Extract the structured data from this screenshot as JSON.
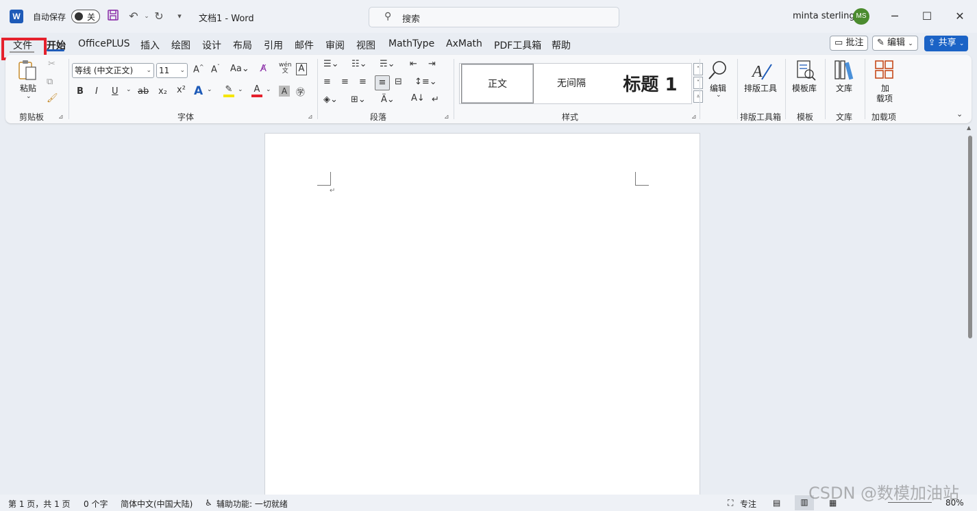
{
  "titlebar": {
    "app_logo": "W",
    "autosave_label": "自动保存",
    "autosave_state": "关",
    "doc_title": "文档1  -  Word",
    "search_placeholder": "搜索",
    "user_name": "minta sterling",
    "user_initials": "MS",
    "minimize": "─",
    "maximize": "☐",
    "close": "✕"
  },
  "tabs": [
    {
      "label": "文件"
    },
    {
      "label": "开始"
    },
    {
      "label": "OfficePLUS"
    },
    {
      "label": "插入"
    },
    {
      "label": "绘图"
    },
    {
      "label": "设计"
    },
    {
      "label": "布局"
    },
    {
      "label": "引用"
    },
    {
      "label": "邮件"
    },
    {
      "label": "审阅"
    },
    {
      "label": "视图"
    },
    {
      "label": "MathType"
    },
    {
      "label": "AxMath"
    },
    {
      "label": "PDF工具箱"
    },
    {
      "label": "帮助"
    }
  ],
  "header_buttons": {
    "comment": "批注",
    "edit": "编辑",
    "share": "共享"
  },
  "ribbon": {
    "clipboard": {
      "paste": "粘贴",
      "label": "剪贴板"
    },
    "font": {
      "name": "等线 (中文正文)",
      "size": "11",
      "label": "字体",
      "bold": "B",
      "italic": "I",
      "underline": "U",
      "strike": "ab",
      "sub": "x₂",
      "sup": "x²",
      "grow": "A^",
      "shrink": "A˅",
      "case": "Aa",
      "phonetic": "wén 文"
    },
    "paragraph": {
      "label": "段落"
    },
    "styles": {
      "label": "样式",
      "items": [
        "正文",
        "无间隔",
        "标题 1"
      ]
    },
    "editing": {
      "label": "编辑"
    },
    "layout_tools": {
      "button": "排版工具",
      "label": "排版工具箱"
    },
    "templates": {
      "button": "模板库",
      "label": "模板"
    },
    "library": {
      "button": "文库",
      "label": "文库"
    },
    "addins": {
      "button": "加\n载项",
      "label": "加载项",
      "btn1": "加",
      "btn2": "载项"
    }
  },
  "statusbar": {
    "page": "第 1 页，共 1 页",
    "words": "0 个字",
    "language": "简体中文(中国大陆)",
    "accessibility": "辅助功能: 一切就绪",
    "focus": "专注",
    "zoom": "80%"
  },
  "watermark": "CSDN @数模加油站",
  "colors": {
    "accent": "#1e5bb8",
    "highlight_box": "#e5212d",
    "avatar": "#4b8b2e"
  }
}
